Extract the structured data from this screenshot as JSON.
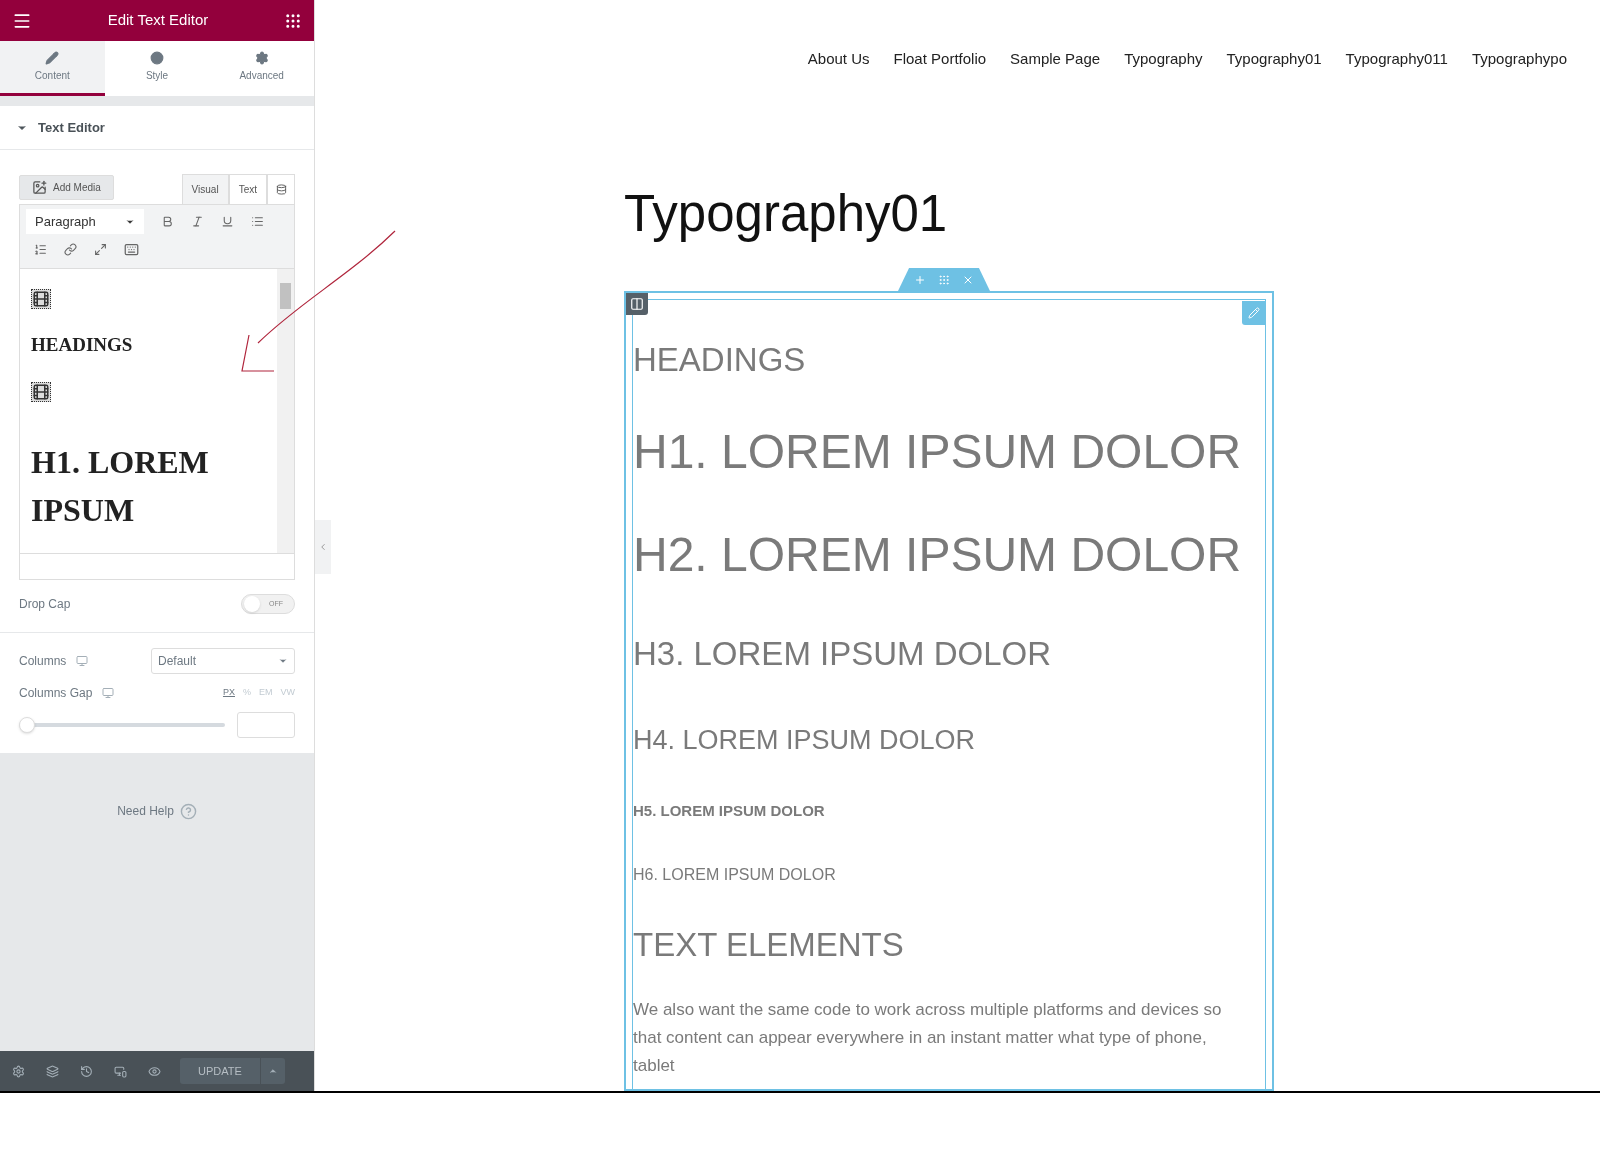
{
  "panel": {
    "title": "Edit Text Editor",
    "tabs": [
      {
        "label": "Content",
        "selected": true
      },
      {
        "label": "Style",
        "selected": false
      },
      {
        "label": "Advanced",
        "selected": false
      }
    ],
    "section": {
      "title": "Text Editor",
      "expanded": true
    },
    "editor": {
      "add_media": "Add Media",
      "modes": [
        {
          "label": "Visual",
          "selected": true
        },
        {
          "label": "Text",
          "selected": false
        }
      ],
      "format": "Paragraph",
      "content": [
        {
          "kind": "media"
        },
        {
          "kind": "heading",
          "text": "HEADINGS"
        },
        {
          "kind": "media"
        },
        {
          "kind": "h1",
          "text": "H1. LOREM IPSUM"
        }
      ]
    },
    "drop_cap": {
      "label": "Drop Cap",
      "on": false,
      "switch_text": "OFF"
    },
    "columns": {
      "label": "Columns",
      "value": "Default"
    },
    "columns_gap": {
      "label": "Columns Gap",
      "units": [
        {
          "label": "PX",
          "selected": true
        },
        {
          "label": "%",
          "selected": false
        },
        {
          "label": "EM",
          "selected": false
        },
        {
          "label": "VW",
          "selected": false
        }
      ],
      "level": 0
    },
    "help": "Need Help",
    "update": "UPDATE"
  },
  "site": {
    "nav": [
      "About Us",
      "Float Portfolio",
      "Sample Page",
      "Typography",
      "Typography01",
      "Typography011",
      "Typographypo"
    ],
    "title": "Typography01",
    "blocks": [
      {
        "kind": "section",
        "text": "HEADINGS"
      },
      {
        "kind": "h1",
        "text": "H1. LOREM IPSUM DOLOR"
      },
      {
        "kind": "h2",
        "text": "H2. LOREM IPSUM DOLOR"
      },
      {
        "kind": "h3",
        "text": "H3. LOREM IPSUM DOLOR"
      },
      {
        "kind": "h4",
        "text": "H4. LOREM IPSUM DOLOR"
      },
      {
        "kind": "h5",
        "text": "H5. LOREM IPSUM DOLOR"
      },
      {
        "kind": "h6",
        "text": "H6. LOREM IPSUM DOLOR"
      },
      {
        "kind": "section",
        "text": "TEXT ELEMENTS"
      },
      {
        "kind": "paragraph",
        "text": "We also want the same code to work across multiple platforms and devices so that content can appear everywhere in an instant matter what type of phone, tablet"
      }
    ]
  }
}
